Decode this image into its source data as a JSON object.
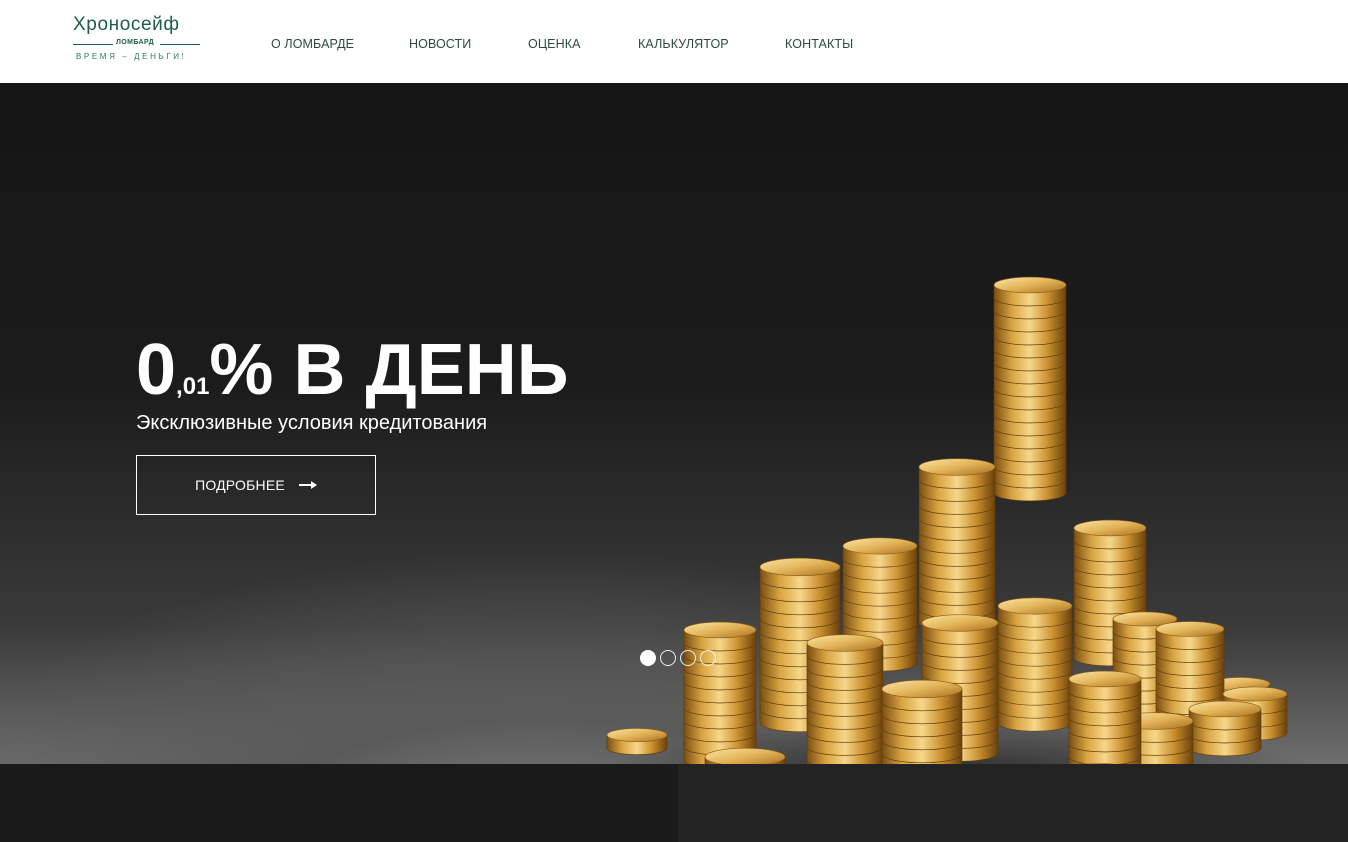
{
  "brand": {
    "name": "Хроносейф",
    "sub": "ЛОМБАРД",
    "tagline": "ВРЕМЯ – ДЕНЬГИ!",
    "color": "#1f5c4a"
  },
  "nav": {
    "items": [
      {
        "label": "О ЛОМБАРДЕ"
      },
      {
        "label": "НОВОСТИ"
      },
      {
        "label": "ОЦЕНКА"
      },
      {
        "label": "КАЛЬКУЛЯТОР"
      },
      {
        "label": "КОНТАКТЫ"
      }
    ]
  },
  "hero": {
    "rate_int": "0",
    "rate_frac": ",01",
    "rate_rest": "% В ДЕНЬ",
    "subtitle": "Эксклюзивные условия кредитования",
    "button_label": "ПОДРОБНЕЕ",
    "button_icon": "arrow-right-icon",
    "slides_total": 4,
    "slide_active": 1
  }
}
